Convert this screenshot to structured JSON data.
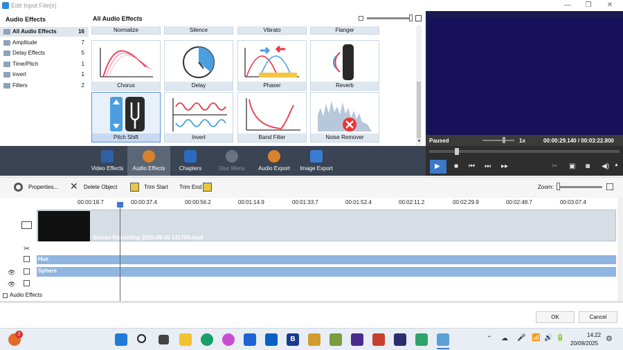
{
  "window": {
    "title": "Edit Input File(s)",
    "controls": [
      "—",
      "❐",
      "✕"
    ]
  },
  "categories": {
    "header": "Audio Effects",
    "items": [
      {
        "label": "All Audio Effects",
        "count": "16"
      },
      {
        "label": "Amplitude",
        "count": "7"
      },
      {
        "label": "Delay Effects",
        "count": "5"
      },
      {
        "label": "Time/Pitch",
        "count": "1"
      },
      {
        "label": "Invert",
        "count": "1"
      },
      {
        "label": "Filters",
        "count": "2"
      }
    ]
  },
  "effects": {
    "title": "All Audio Effects",
    "top_row": [
      "Normalize",
      "Silence",
      "Vibrato",
      "Flanger"
    ],
    "tiles": [
      "Chorus",
      "Delay",
      "Phaser",
      "Reverb",
      "Pitch Shift",
      "Invert",
      "Band Filter",
      "Noise Remover"
    ]
  },
  "preview": {
    "state": "Paused",
    "speed": "1x",
    "time": "00:00:29.140 / 00:03:22.800"
  },
  "toolbar": {
    "items": [
      "Video Effects",
      "Audio Effects",
      "Chapters",
      "Disc Menu",
      "Audio Export",
      "Image Export"
    ]
  },
  "objects": {
    "properties": "Properties...",
    "delete": "Delete Object",
    "trim_start": "Trim Start",
    "trim_end": "Trim End",
    "zoom": "Zoom:"
  },
  "ruler": {
    "ticks": [
      "00:00:18.7",
      "00:00:37.4",
      "00:00:56.2",
      "00:01:14.9",
      "00:01:33.7",
      "00:01:52.4",
      "00:02:11.2",
      "00:02:29.9",
      "00:02:48.7",
      "00:03:07.4"
    ]
  },
  "tracks": {
    "clip": "Screen Recording 2025-09-20 141704.mp4",
    "hue": "Hue",
    "sphere": "Sphere",
    "group": "Audio Effects"
  },
  "dialog": {
    "ok": "OK",
    "cancel": "Cancel"
  },
  "taskbar": {
    "time": "14:22",
    "date": "20/09/2025",
    "badge": "2",
    "b_app": "B"
  }
}
